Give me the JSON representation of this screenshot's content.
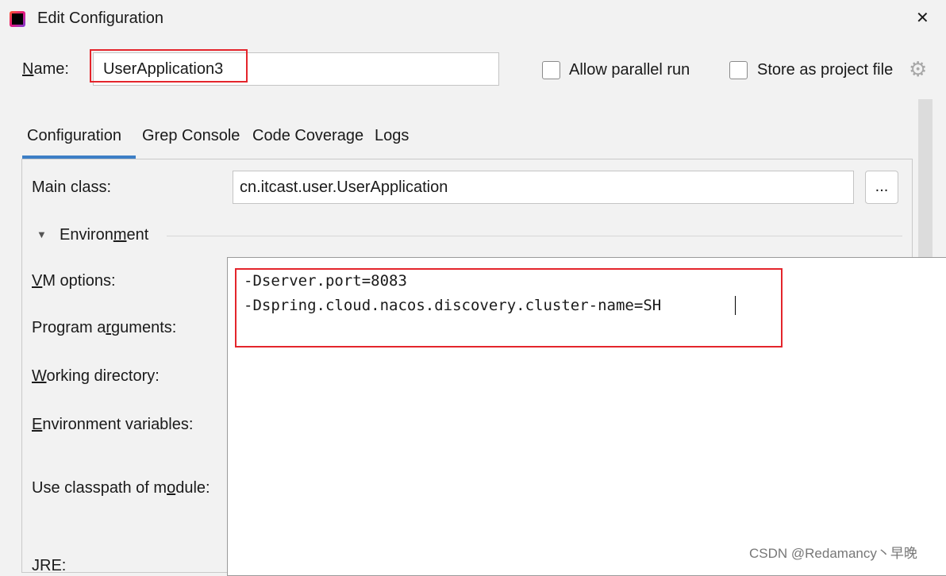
{
  "window": {
    "title": "Edit Configuration",
    "close": "✕"
  },
  "name": {
    "label": "Name:",
    "value": "UserApplication3"
  },
  "options": {
    "allow_parallel": "Allow parallel run",
    "allow_parallel_checked": false,
    "store_as_file": "Store as project file",
    "store_as_file_checked": false
  },
  "tabs": [
    {
      "label": "Configuration",
      "active": true
    },
    {
      "label": "Grep Console"
    },
    {
      "label": "Code Coverage"
    },
    {
      "label": "Logs"
    }
  ],
  "main_class": {
    "label": "Main class:",
    "value": "cn.itcast.user.UserApplication",
    "browse": "..."
  },
  "environment": {
    "label": "Environment"
  },
  "fields": {
    "vm_options": "VM options:",
    "program_arguments": "Program arguments:",
    "working_directory": "Working directory:",
    "environment_variables": "Environment variables:",
    "classpath_module": "Use classpath of module:",
    "jre": "JRE:"
  },
  "vm_options_text": [
    "-Dserver.port=8083",
    "-Dspring.cloud.nacos.discovery.cluster-name=SH"
  ],
  "watermark": "CSDN @Redamancy丶早晚",
  "colors": {
    "accent": "#3d7fc6",
    "highlight": "#e4252c"
  }
}
